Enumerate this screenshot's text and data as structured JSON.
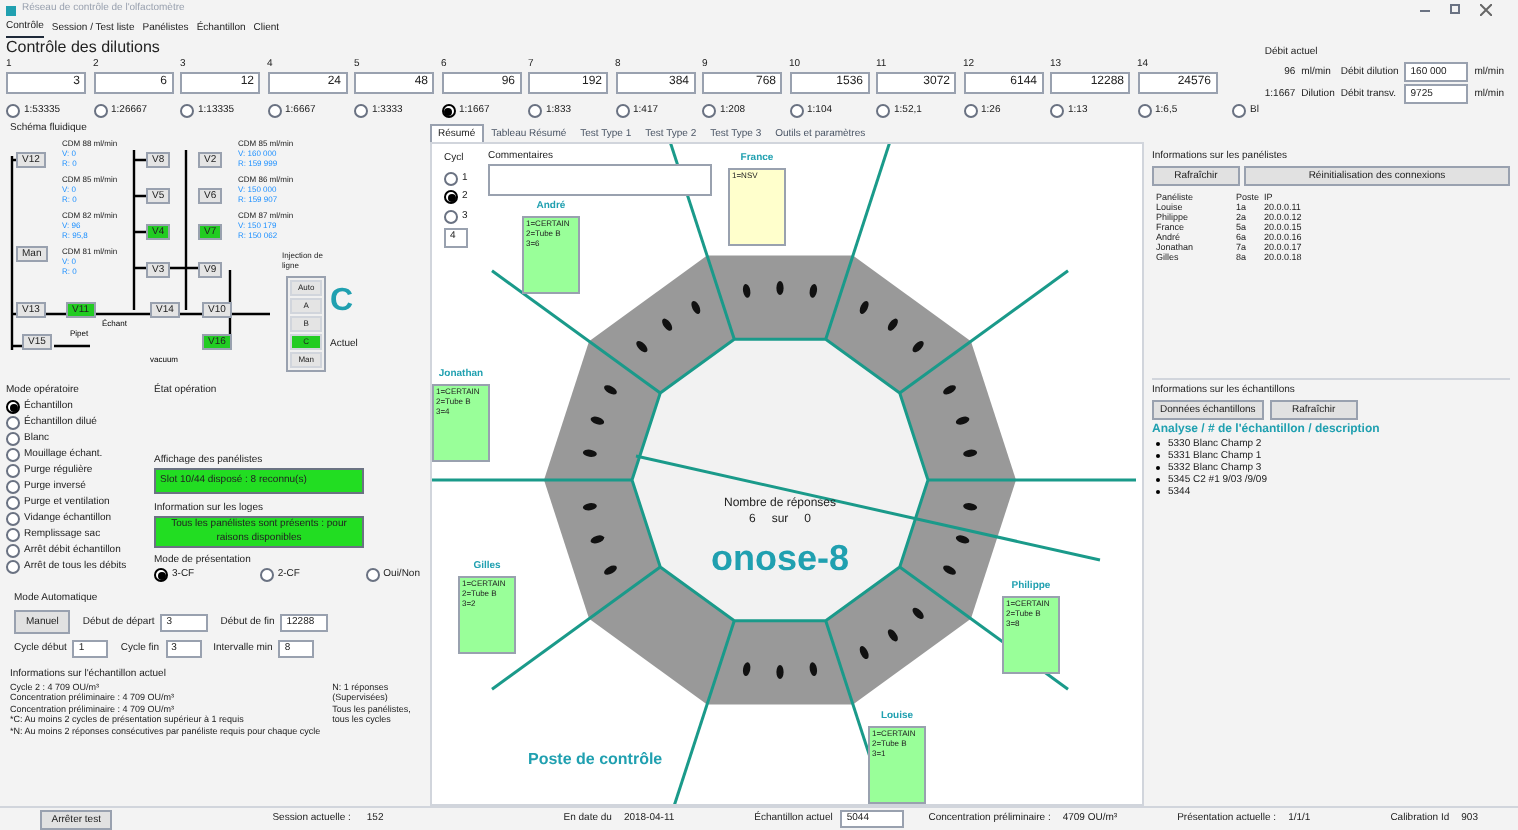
{
  "window": {
    "title": "Réseau de contrôle de l'olfactomètre"
  },
  "menu": [
    {
      "label": "Contrôle",
      "selected": true
    },
    {
      "label": "Session / Test liste",
      "selected": false
    },
    {
      "label": "Panélistes",
      "selected": false
    },
    {
      "label": "Échantillon",
      "selected": false
    },
    {
      "label": "Client",
      "selected": false
    }
  ],
  "dilutions": {
    "title": "Contrôle des dilutions",
    "steps": [
      {
        "index": "1",
        "value": "3",
        "ratio": "1:53335",
        "selected": false
      },
      {
        "index": "2",
        "value": "6",
        "ratio": "1:26667",
        "selected": false
      },
      {
        "index": "3",
        "value": "12",
        "ratio": "1:13335",
        "selected": false
      },
      {
        "index": "4",
        "value": "24",
        "ratio": "1:6667",
        "selected": false
      },
      {
        "index": "5",
        "value": "48",
        "ratio": "1:3333",
        "selected": false
      },
      {
        "index": "6",
        "value": "96",
        "ratio": "1:1667",
        "selected": true
      },
      {
        "index": "7",
        "value": "192",
        "ratio": "1:833",
        "selected": false
      },
      {
        "index": "8",
        "value": "384",
        "ratio": "1:417",
        "selected": false
      },
      {
        "index": "9",
        "value": "768",
        "ratio": "1:208",
        "selected": false
      },
      {
        "index": "10",
        "value": "1536",
        "ratio": "1:104",
        "selected": false
      },
      {
        "index": "11",
        "value": "3072",
        "ratio": "1:52,1",
        "selected": false
      },
      {
        "index": "12",
        "value": "6144",
        "ratio": "1:26",
        "selected": false
      },
      {
        "index": "13",
        "value": "12288",
        "ratio": "1:13",
        "selected": false
      },
      {
        "index": "14",
        "value": "24576",
        "ratio": "1:6,5",
        "selected": false
      }
    ],
    "blank": {
      "label": "Bl",
      "selected": false
    }
  },
  "flow": {
    "label": "Débit actuel",
    "current": "96",
    "current_unit": "ml/min",
    "ratio": "1:1667",
    "ratio_label": "Dilution",
    "dilution_label": "Débit dilution",
    "dilution_value": "160 000",
    "dilution_unit": "ml/min",
    "transverse_label": "Débit transv.",
    "transverse_value": "9725",
    "transverse_unit": "ml/min"
  },
  "schematic": {
    "title": "Schéma fluidique",
    "valves": [
      {
        "label": "V12",
        "on": false
      },
      {
        "label": "Man",
        "on": false
      },
      {
        "label": "V8",
        "on": false
      },
      {
        "label": "V5",
        "on": false
      },
      {
        "label": "V4",
        "on": true
      },
      {
        "label": "V3",
        "on": false
      },
      {
        "label": "V2",
        "on": false
      },
      {
        "label": "V6",
        "on": false
      },
      {
        "label": "V7",
        "on": true
      },
      {
        "label": "V9",
        "on": false
      },
      {
        "label": "V13",
        "on": false
      },
      {
        "label": "V11",
        "on": true
      },
      {
        "label": "V14",
        "on": false
      },
      {
        "label": "V15",
        "on": false
      },
      {
        "label": "V10",
        "on": false
      },
      {
        "label": "V16",
        "on": true
      }
    ],
    "flowmeters": [
      {
        "title": "CDM 88 ml/min",
        "set": "V: 0",
        "read": "R: 0"
      },
      {
        "title": "CDM 85 ml/min",
        "set": "V: 0",
        "read": "R: 0"
      },
      {
        "title": "CDM 82 ml/min",
        "set": "V: 96",
        "read": "R: 95,8"
      },
      {
        "title": "CDM 81 ml/min",
        "set": "V: 0",
        "read": "R: 0"
      },
      {
        "title": "CDM 85 ml/min",
        "set": "V: 160 000",
        "read": "R: 159 999"
      },
      {
        "title": "CDM 86 ml/min",
        "set": "V: 150 000",
        "read": "R: 159 907"
      },
      {
        "title": "CDM 87 ml/min",
        "set": "V: 150 179",
        "read": "R: 150 062"
      }
    ],
    "labels": [
      "Échant",
      "Pipet",
      "vacuum"
    ],
    "injection": {
      "title": "Injection de ligne",
      "options": [
        {
          "label": "Auto",
          "selected": false
        },
        {
          "label": "A",
          "selected": false
        },
        {
          "label": "B",
          "selected": false
        },
        {
          "label": "C",
          "selected": true
        },
        {
          "label": "Man",
          "selected": false
        }
      ],
      "current": "C",
      "current_label": "Actuel"
    }
  },
  "mode": {
    "title": "Mode opératoire",
    "items": [
      {
        "label": "Échantillon",
        "selected": true
      },
      {
        "label": "Échantillon dilué",
        "selected": false
      },
      {
        "label": "Blanc",
        "selected": false
      },
      {
        "label": "Mouillage échant.",
        "selected": false
      },
      {
        "label": "Purge régulière",
        "selected": false
      },
      {
        "label": "Purge inversé",
        "selected": false
      },
      {
        "label": "Purge et ventilation",
        "selected": false
      },
      {
        "label": "Vidange échantillon",
        "selected": false
      },
      {
        "label": "Remplissage sac",
        "selected": false
      },
      {
        "label": "Arrêt débit échantillon",
        "selected": false
      },
      {
        "label": "Arrêt de tous les débits",
        "selected": false
      }
    ]
  },
  "operation": {
    "title": "État opération",
    "panelists_title": "Affichage des panélistes",
    "panelists_message": "Slot 10/44 disposé : 8 reconnu(s)",
    "booths_title": "Information sur les loges",
    "booths_message": "Tous les panélistes sont présents : pour raisons disponibles",
    "presentation_title": "Mode de présentation",
    "presentation": [
      {
        "label": "3-CF",
        "selected": true
      },
      {
        "label": "2-CF",
        "selected": false
      },
      {
        "label": "Oui/Non",
        "selected": false
      }
    ]
  },
  "auto": {
    "title": "Mode Automatique",
    "button": "Manuel",
    "fields": [
      {
        "label": "Début de départ",
        "value": "3"
      },
      {
        "label": "Début de fin",
        "value": "12288"
      },
      {
        "label": "Cycle début",
        "value": "1"
      },
      {
        "label": "Cycle fin",
        "value": "3"
      },
      {
        "label": "Intervalle min",
        "value": "8"
      }
    ]
  },
  "sample_info": {
    "title": "Informations sur l'échantillon actuel",
    "lines": [
      "Cycle 2 : 4 709 OU/m³",
      "Concentration préliminaire : 4 709 OU/m³",
      "Concentration préliminaire : 4 709 OU/m³",
      "*C: Au moins 2 cycles de présentation supérieur à 1 requis",
      "*N: Au moins 2 réponses consécutives par panéliste requis pour chaque cycle"
    ],
    "notes": [
      "N: 1 réponses",
      "(Supervisées)",
      "Tous les panélistes, tous les cycles"
    ]
  },
  "tabs": [
    {
      "label": "Résumé",
      "selected": true
    },
    {
      "label": "Tableau Résumé",
      "selected": false
    },
    {
      "label": "Test Type 1",
      "selected": false
    },
    {
      "label": "Test Type 2",
      "selected": false
    },
    {
      "label": "Test Type 3",
      "selected": false
    },
    {
      "label": "Outils et paramètres",
      "selected": false
    }
  ],
  "cycle": {
    "label": "Cycl",
    "options": [
      {
        "label": "1",
        "selected": false
      },
      {
        "label": "2",
        "selected": true
      },
      {
        "label": "3",
        "selected": false
      }
    ],
    "value": "4"
  },
  "comments": {
    "label": "Commentaires"
  },
  "panelists": [
    {
      "name": "France",
      "lines": [
        "1=NSV"
      ],
      "color": "#ffffcc"
    },
    {
      "name": "André",
      "lines": [
        "1=CERTAIN",
        "2=Tube B",
        "3=6"
      ],
      "color": "#99ff99"
    },
    {
      "name": "Jonathan",
      "lines": [
        "1=CERTAIN",
        "2=Tube B",
        "3=4"
      ],
      "color": "#99ff99"
    },
    {
      "name": "Gilles",
      "lines": [
        "1=CERTAIN",
        "2=Tube B",
        "3=2"
      ],
      "color": "#99ff99"
    },
    {
      "name": "Louise",
      "lines": [
        "1=CERTAIN",
        "2=Tube B",
        "3=1"
      ],
      "color": "#99ff99"
    },
    {
      "name": "Philippe",
      "lines": [
        "1=CERTAIN",
        "2=Tube B",
        "3=8"
      ],
      "color": "#99ff99"
    }
  ],
  "wheel": {
    "responses_label": "Nombre de réponses",
    "responses": "6",
    "of": "sur",
    "total": "0",
    "logo": "onose-8",
    "control_post": "Poste de contrôle"
  },
  "panelist_info": {
    "title": "Informations sur les panélistes",
    "refresh": "Rafraîchir",
    "reset": "Réinitialisation des connexions",
    "columns": [
      "Panéliste",
      "Poste",
      "IP"
    ],
    "rows": [
      [
        "Louise",
        "1a",
        "20.0.0.11"
      ],
      [
        "Philippe",
        "2a",
        "20.0.0.12"
      ],
      [
        "France",
        "5a",
        "20.0.0.15"
      ],
      [
        "André",
        "6a",
        "20.0.0.16"
      ],
      [
        "Jonathan",
        "7a",
        "20.0.0.17"
      ],
      [
        "Gilles",
        "8a",
        "20.0.0.18"
      ]
    ]
  },
  "sample_list": {
    "title": "Informations sur les échantillons",
    "data_button": "Données échantillons",
    "refresh": "Rafraîchir",
    "heading": "Analyse / # de l'échantillon / description",
    "items": [
      "5330 Blanc Champ 2",
      "5331 Blanc Champ 1",
      "5332 Blanc Champ 3",
      "5345 C2 #1 9/03 /9/09",
      "5344"
    ]
  },
  "status_bar": {
    "stop": "Arrêter test",
    "session_label": "Session actuelle :",
    "session": "152",
    "date_label": "En date du",
    "date": "2018-04-11",
    "sample_label": "Échantillon actuel",
    "sample": "5044",
    "conc_label": "Concentration préliminaire :",
    "conc": "4709 OU/m³",
    "presentation_label": "Présentation actuelle :",
    "presentation": "1/1/1",
    "calibration_label": "Calibration Id",
    "calibration": "903"
  }
}
